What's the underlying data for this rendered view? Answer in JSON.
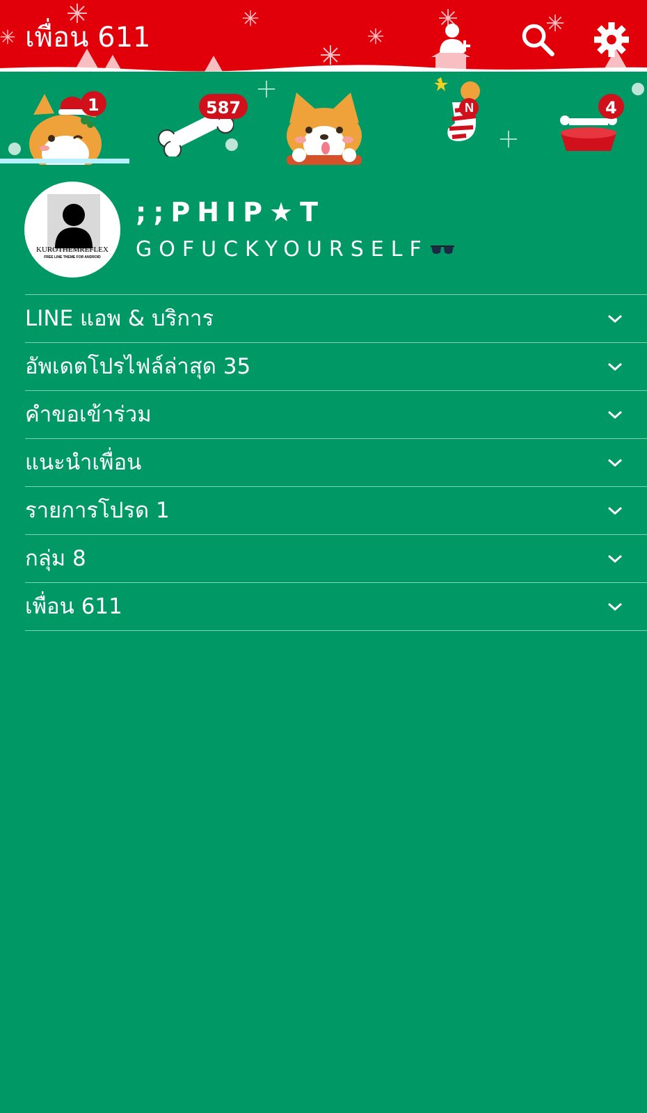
{
  "header": {
    "title": "เพื่อน 611",
    "icons": [
      "add-friend-icon",
      "search-icon",
      "gear-icon"
    ]
  },
  "tabs": [
    {
      "name": "friends",
      "badge": "1",
      "active": true
    },
    {
      "name": "chats",
      "badge": "587",
      "active": false
    },
    {
      "name": "timeline",
      "badge": "",
      "active": false
    },
    {
      "name": "news",
      "badge": "",
      "active": false
    },
    {
      "name": "more",
      "badge": "4",
      "active": false
    }
  ],
  "profile": {
    "name": ";;PHIP★T",
    "status": "GOFUCKYOURSELF",
    "status_emoji": "🕶",
    "avatar_text": "KUROTHEMREFLEX",
    "avatar_subtext": "FREE LINE THEME FOR ANDROID"
  },
  "sections": [
    {
      "label": "LINE แอพ & บริการ"
    },
    {
      "label": "อัพเดตโปรไฟล์ล่าสุด 35"
    },
    {
      "label": "คำขอเข้าร่วม"
    },
    {
      "label": "แนะนำเพื่อน"
    },
    {
      "label": "รายการโปรด 1"
    },
    {
      "label": "กลุ่ม 8"
    },
    {
      "label": "เพื่อน 611"
    }
  ],
  "colors": {
    "header_bg": "#e1000a",
    "body_bg": "#009966",
    "badge": "#d0101a",
    "tab_indicator": "#b8f0ff"
  }
}
